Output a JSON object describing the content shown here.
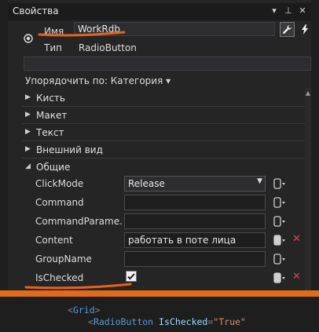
{
  "panel": {
    "title": "Свойства"
  },
  "titlebar_icons": [
    "▾",
    "⊥",
    "✕"
  ],
  "header": {
    "name_label": "Имя",
    "name_value": "WorkRdb",
    "type_label": "Тип",
    "type_value": "RadioButton"
  },
  "search": {
    "placeholder": ""
  },
  "sort_label": "Упорядочить по: Категория ▾",
  "categories": [
    "Кисть",
    "Макет",
    "Текст",
    "Внешний вид",
    "Общие"
  ],
  "props": [
    {
      "name": "ClickMode",
      "value": "Release"
    },
    {
      "name": "Command",
      "value": ""
    },
    {
      "name": "CommandParame...",
      "value": ""
    },
    {
      "name": "Content",
      "value": "работать в поте лица"
    },
    {
      "name": "GroupName",
      "value": ""
    },
    {
      "name": "IsChecked",
      "value": ""
    }
  ],
  "code": {
    "l1_tag": "Grid",
    "l2_tag": "RadioButton",
    "l2_attr": "IsChecked",
    "l2_val": "\"True\""
  },
  "colors": {
    "accent": "#e06c19",
    "remove": "#d34b4b"
  }
}
